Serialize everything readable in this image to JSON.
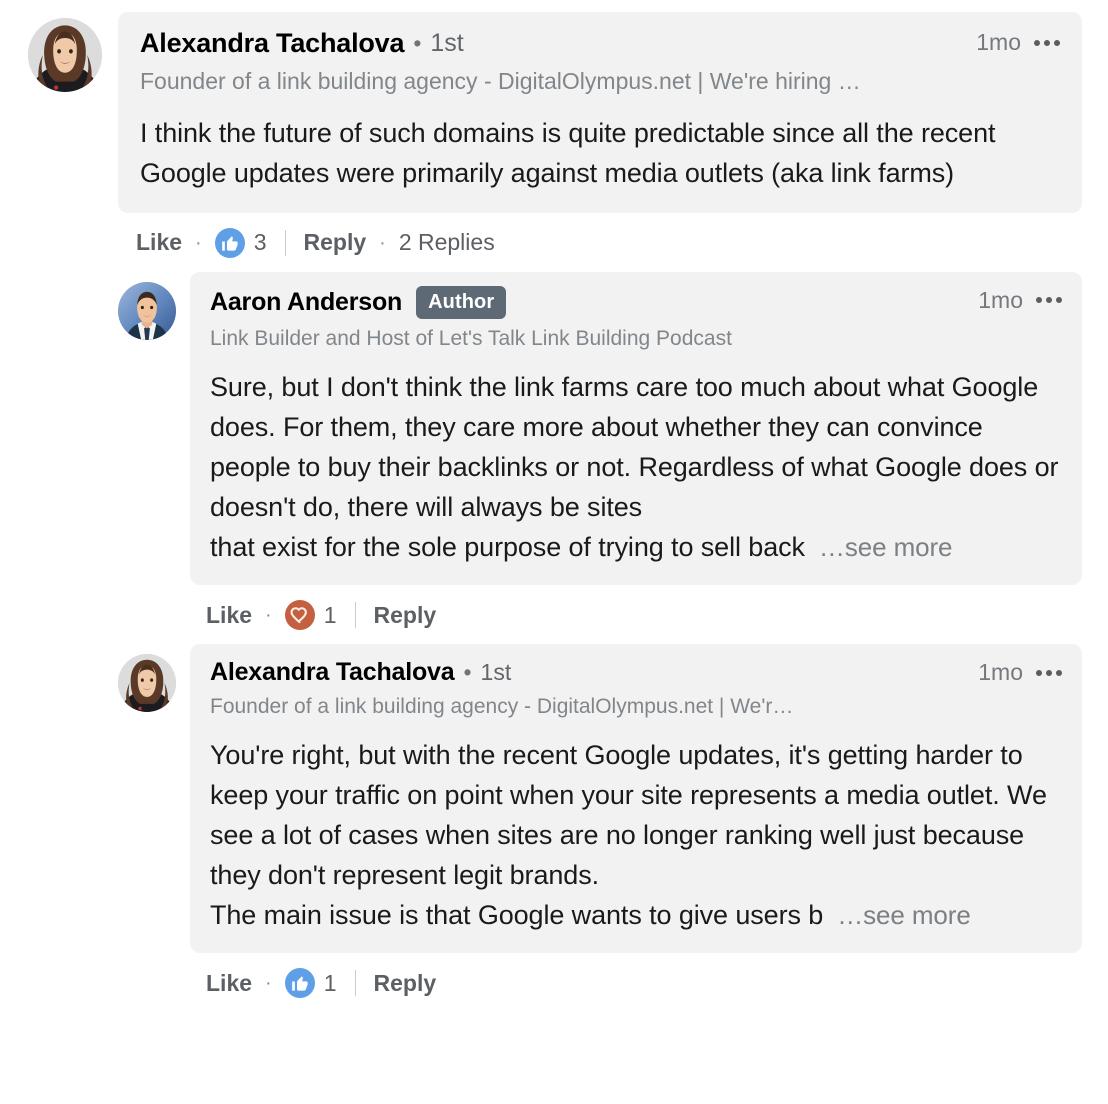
{
  "theme": {
    "page_bg": "#ffffff",
    "bubble_bg": "#f2f2f2",
    "text_primary": "#1a1a1a",
    "text_muted": "#81868b",
    "action_color": "#5c6065",
    "author_badge_bg": "#5d6975",
    "like_reaction_bg": "#5f9fe8",
    "love_reaction_bg": "#c4603f"
  },
  "comments": [
    {
      "id": "comment-1",
      "level": 0,
      "avatar": {
        "name": "alexandra-tachalova-avatar",
        "alt": "Alexandra Tachalova profile photo"
      },
      "author_name": "Alexandra Tachalova",
      "separator": "•",
      "degree": "1st",
      "is_author": false,
      "badge_label": "",
      "headline": "Founder of a link building agency - DigitalOlympus.net | We're hiring …",
      "timestamp": "1mo",
      "text": "I think the future of such domains is quite predictable since all the recent Google updates were primarily against media outlets (aka link farms)",
      "truncated": false,
      "truncated_visible": "",
      "see_more_label": "",
      "actions": {
        "like_label": "Like",
        "dot": "·",
        "reaction_type": "like",
        "reaction_count": "3",
        "reply_label": "Reply",
        "replies_label": "2 Replies",
        "has_replies_count": true
      }
    },
    {
      "id": "comment-2",
      "level": 1,
      "avatar": {
        "name": "aaron-anderson-avatar",
        "alt": "Aaron Anderson profile photo"
      },
      "author_name": "Aaron Anderson",
      "separator": "",
      "degree": "",
      "is_author": true,
      "badge_label": "Author",
      "headline": "Link Builder and Host of Let's Talk Link Building Podcast",
      "timestamp": "1mo",
      "text": "Sure, but I don't think the link farms care too much about what Google does. For them, they care more about whether they can convince people to buy their backlinks or not. Regardless of what Google does or doesn't do, there will always be sites",
      "truncated": true,
      "truncated_visible": "that exist for the sole purpose of trying to sell back",
      "see_more_label": "…see more",
      "actions": {
        "like_label": "Like",
        "dot": "·",
        "reaction_type": "love",
        "reaction_count": "1",
        "reply_label": "Reply",
        "replies_label": "",
        "has_replies_count": false
      }
    },
    {
      "id": "comment-3",
      "level": 1,
      "avatar": {
        "name": "alexandra-tachalova-avatar",
        "alt": "Alexandra Tachalova profile photo"
      },
      "author_name": "Alexandra Tachalova",
      "separator": "•",
      "degree": "1st",
      "is_author": false,
      "badge_label": "",
      "headline": "Founder of a link building agency - DigitalOlympus.net | We'r…",
      "timestamp": "1mo",
      "text": "You're right, but with the recent Google updates, it's getting harder to keep your traffic on point when your site represents a media outlet. We see a lot of cases when sites are no longer ranking well just because they don't represent legit brands.",
      "truncated": true,
      "truncated_visible": "The main issue is that Google wants to give users b",
      "see_more_label": "…see more",
      "actions": {
        "like_label": "Like",
        "dot": "·",
        "reaction_type": "like",
        "reaction_count": "1",
        "reply_label": "Reply",
        "replies_label": "",
        "has_replies_count": false
      }
    }
  ]
}
